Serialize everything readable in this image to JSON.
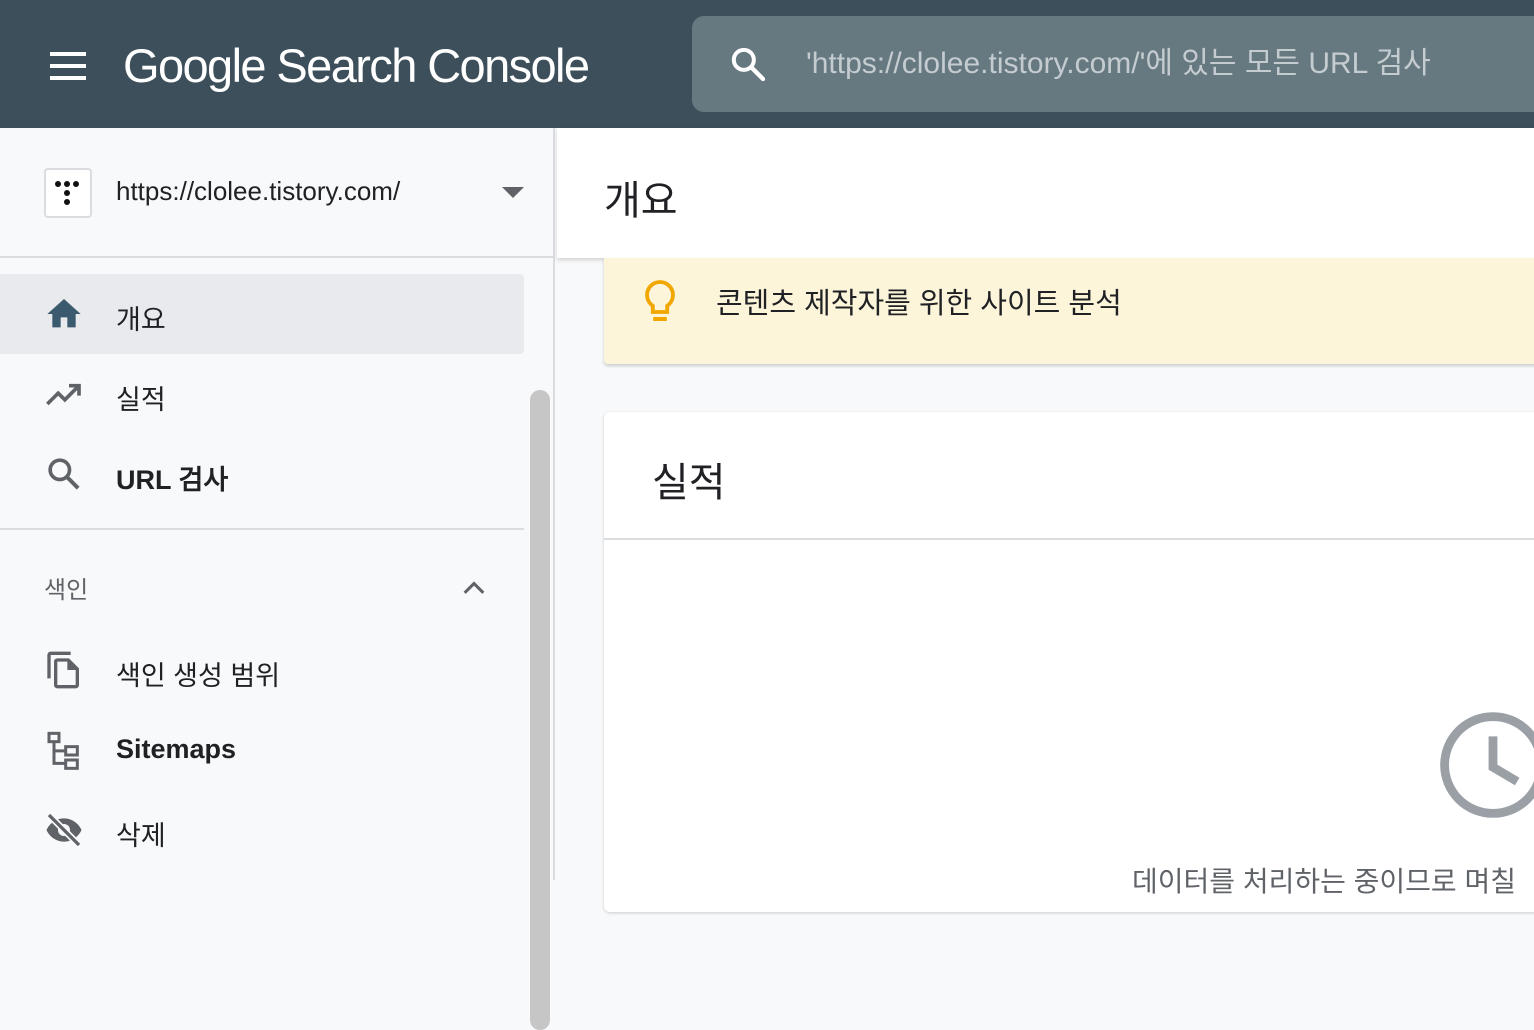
{
  "header": {
    "logo_text": "Google Search Console",
    "search_placeholder": "'https://clolee.tistory.com/'에 있는 모든 URL 검사"
  },
  "property": {
    "url": "https://clolee.tistory.com/"
  },
  "sidebar": {
    "items": [
      {
        "label": "개요",
        "icon": "home-icon",
        "active": true
      },
      {
        "label": "실적",
        "icon": "trending-up-icon"
      },
      {
        "label": "URL 검사",
        "icon": "search-icon"
      }
    ],
    "sections": [
      {
        "title": "색인",
        "expanded": true,
        "items": [
          {
            "label": "색인 생성 범위",
            "icon": "file-copy-icon"
          },
          {
            "label": "Sitemaps",
            "icon": "sitemap-icon"
          },
          {
            "label": "삭제",
            "icon": "eye-off-icon"
          }
        ]
      }
    ]
  },
  "main": {
    "page_title": "개요",
    "banner_text": "콘텐츠 제작자를 위한 사이트 분석",
    "card_title": "실적",
    "card_message": "데이터를 처리하는 중이므로 며칠"
  },
  "colors": {
    "topbar": "#3c4f5a",
    "search_box": "#667880",
    "banner_bg": "#fdf5da",
    "bulb": "#f2a600",
    "nav_icon": "#5f6368",
    "home_icon": "#3c5a6e"
  }
}
